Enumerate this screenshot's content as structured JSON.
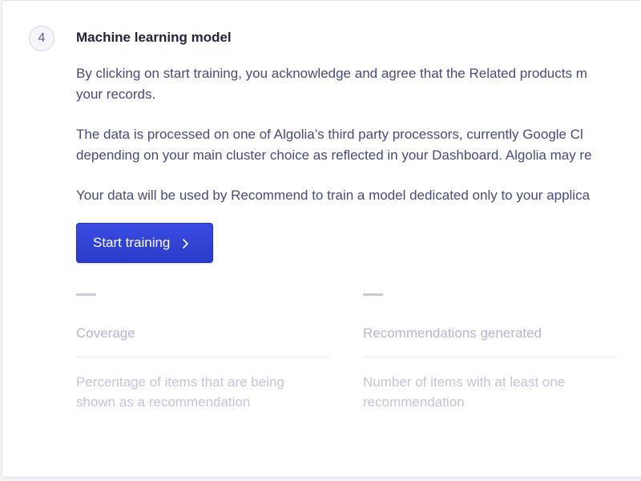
{
  "step": {
    "number": "4",
    "title": "Machine learning model"
  },
  "paragraphs": [
    {
      "lines": [
        "By clicking on start training, you acknowledge and agree that the Related products m",
        "your records."
      ]
    },
    {
      "lines": [
        "The data is processed on one of Algolia’s third party processors, currently Google Cl",
        "depending on your main cluster choice as reflected in your Dashboard. Algolia may re"
      ]
    },
    {
      "lines": [
        "Your data will be used by Recommend to train a model dedicated only to your applica"
      ]
    }
  ],
  "button": {
    "label": "Start training",
    "icon": "chevron-right-icon",
    "color": "#3a4be0"
  },
  "metrics": [
    {
      "value": "—",
      "label": "Coverage",
      "description_lines": [
        "Percentage of items that are being",
        "shown as a recommendation"
      ]
    },
    {
      "value": "—",
      "label": "Recommendations generated",
      "description_lines": [
        "Number of items with at least one",
        "recommendation"
      ]
    }
  ]
}
